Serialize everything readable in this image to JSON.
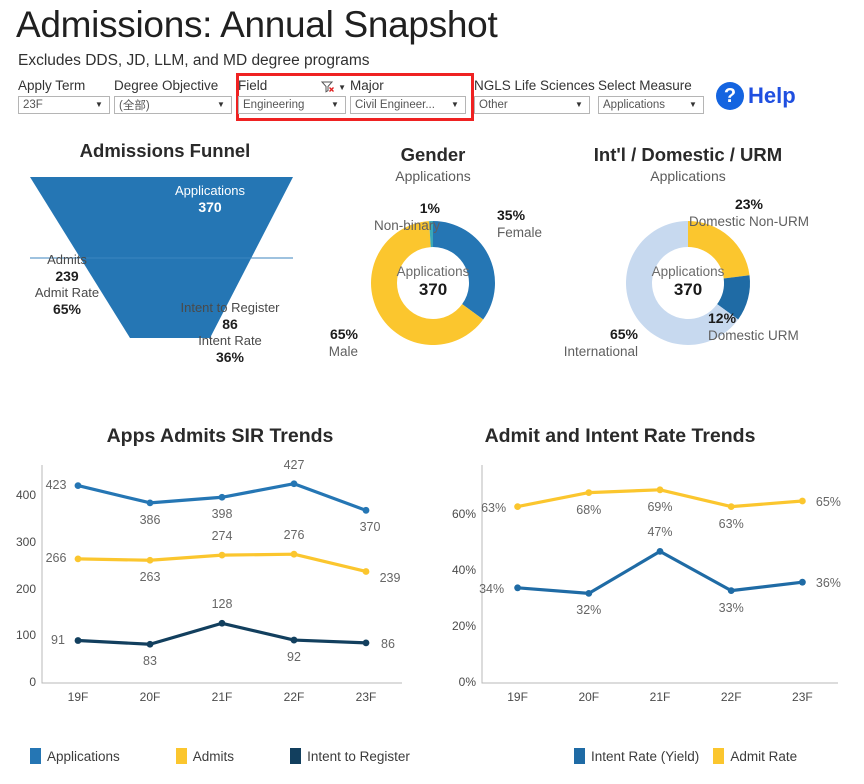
{
  "header": {
    "title": "Admissions: Annual Snapshot",
    "subtitle": "Excludes DDS, JD, LLM, and MD degree programs",
    "help_label": "Help",
    "help_icon": "question-mark-icon"
  },
  "filters": [
    {
      "label": "Apply Term",
      "value": "23F",
      "has_clear_filter": false
    },
    {
      "label": "Degree Objective",
      "value": "(全部)",
      "has_clear_filter": false
    },
    {
      "label": "Field",
      "value": "Engineering",
      "has_clear_filter": true
    },
    {
      "label": "Major",
      "value": "Civil Engineer...",
      "has_clear_filter": false
    },
    {
      "label": "NGLS Life Sciences",
      "value": "Other",
      "has_clear_filter": false
    },
    {
      "label": "Select Measure",
      "value": "Applications",
      "has_clear_filter": false
    }
  ],
  "colors": {
    "blue": "#2576b4",
    "yellow": "#fbc62e",
    "navy": "#123f5e",
    "steel": "#1f6ba5",
    "lightblue": "#c7d9ef",
    "teal": "#3aa8b8",
    "highlight_red": "#ef2222",
    "help_blue": "#1f4fe0"
  },
  "funnel": {
    "title": "Admissions Funnel",
    "stages": [
      {
        "name": "Applications",
        "value": "370"
      },
      {
        "name": "Admits",
        "value": "239",
        "rate_label": "Admit Rate",
        "rate": "65%"
      },
      {
        "name": "Intent to Register",
        "value": "86",
        "rate_label": "Intent Rate",
        "rate": "36%"
      }
    ]
  },
  "donut_gender": {
    "title": "Gender",
    "subtitle": "Applications",
    "center_label": "Applications",
    "center_value": "370",
    "slices": [
      {
        "label": "Female",
        "pct": "35%",
        "value": 35,
        "color": "#2576b4"
      },
      {
        "label": "Male",
        "pct": "65%",
        "value": 64,
        "color": "#fbc62e"
      },
      {
        "label": "Non-binary",
        "pct": "1%",
        "value": 1,
        "color": "#3aa8b8"
      }
    ]
  },
  "donut_urm": {
    "title": "Int'l / Domestic / URM",
    "subtitle": "Applications",
    "center_label": "Applications",
    "center_value": "370",
    "slices": [
      {
        "label": "Domestic Non-URM",
        "pct": "23%",
        "value": 23,
        "color": "#fbc62e"
      },
      {
        "label": "Domestic URM",
        "pct": "12%",
        "value": 12,
        "color": "#1f6ba5"
      },
      {
        "label": "International",
        "pct": "65%",
        "value": 65,
        "color": "#c7d9ef"
      }
    ]
  },
  "chart_data": [
    {
      "id": "apps-admits-sir-trends",
      "type": "line",
      "title": "Apps Admits SIR Trends",
      "xlabel": "",
      "ylabel": "",
      "categories": [
        "19F",
        "20F",
        "21F",
        "22F",
        "23F"
      ],
      "yticks": [
        "0",
        "100",
        "200",
        "300",
        "400"
      ],
      "ylim": [
        0,
        450
      ],
      "grid": false,
      "legend_position": "bottom",
      "series": [
        {
          "name": "Applications",
          "color": "#2576b4",
          "values": [
            423,
            386,
            398,
            427,
            370
          ],
          "labels": [
            "423",
            "386",
            "398",
            "427",
            "370"
          ]
        },
        {
          "name": "Admits",
          "color": "#fbc62e",
          "values": [
            266,
            263,
            274,
            276,
            239
          ],
          "labels": [
            "266",
            "263",
            "274",
            "276",
            "239"
          ]
        },
        {
          "name": "Intent to Register",
          "color": "#123f5e",
          "values": [
            91,
            83,
            128,
            92,
            86
          ],
          "labels": [
            "91",
            "83",
            "128",
            "92",
            "86"
          ]
        }
      ]
    },
    {
      "id": "admit-intent-rate-trends",
      "type": "line",
      "title": "Admit and Intent Rate Trends",
      "xlabel": "",
      "ylabel": "",
      "categories": [
        "19F",
        "20F",
        "21F",
        "22F",
        "23F"
      ],
      "yticks": [
        "0%",
        "20%",
        "40%",
        "60%"
      ],
      "ylim": [
        0,
        75
      ],
      "grid": false,
      "legend_position": "bottom",
      "series": [
        {
          "name": "Admit Rate",
          "color": "#fbc62e",
          "values": [
            63,
            68,
            69,
            63,
            65
          ],
          "labels": [
            "63%",
            "68%",
            "69%",
            "63%",
            "65%"
          ]
        },
        {
          "name": "Intent Rate (Yield)",
          "color": "#1f6ba5",
          "values": [
            34,
            32,
            47,
            33,
            36
          ],
          "labels": [
            "34%",
            "32%",
            "47%",
            "33%",
            "36%"
          ]
        }
      ]
    }
  ],
  "legend_left": [
    {
      "label": "Applications",
      "color": "#2576b4"
    },
    {
      "label": "Admits",
      "color": "#fbc62e"
    },
    {
      "label": "Intent to Register",
      "color": "#123f5e"
    }
  ],
  "legend_right": [
    {
      "label": "Intent Rate (Yield)",
      "color": "#1f6ba5"
    },
    {
      "label": "Admit Rate",
      "color": "#fbc62e"
    }
  ]
}
